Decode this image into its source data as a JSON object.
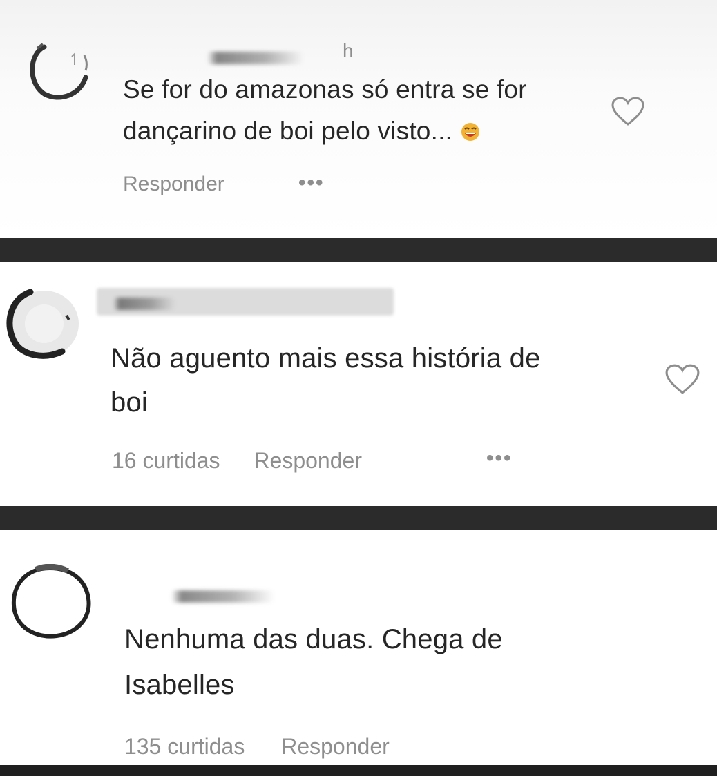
{
  "comments": [
    {
      "username": "",
      "time": "h",
      "text_line1": "Se for do amazonas só entra se for",
      "text_line2": "dançarino de boi pelo visto...",
      "emoji": "laughing-face",
      "likes": "",
      "reply_label": "Responder",
      "more_label": "•••"
    },
    {
      "username": "",
      "time": "",
      "text_line1": "Não aguento mais essa história de",
      "text_line2": "boi",
      "likes": "16 curtidas",
      "reply_label": "Responder",
      "more_label": "•••"
    },
    {
      "username": "",
      "time": "",
      "text_line1": "Nenhuma das duas. Chega de",
      "text_line2": "Isabelles",
      "likes": "135 curtidas",
      "reply_label": "Responder"
    }
  ],
  "icons": {
    "like": "heart-outline-icon",
    "avatar": "profile-avatar-icon"
  },
  "colors": {
    "text": "#262626",
    "secondary": "#8e8e8e",
    "divider": "#2b2b2b"
  }
}
